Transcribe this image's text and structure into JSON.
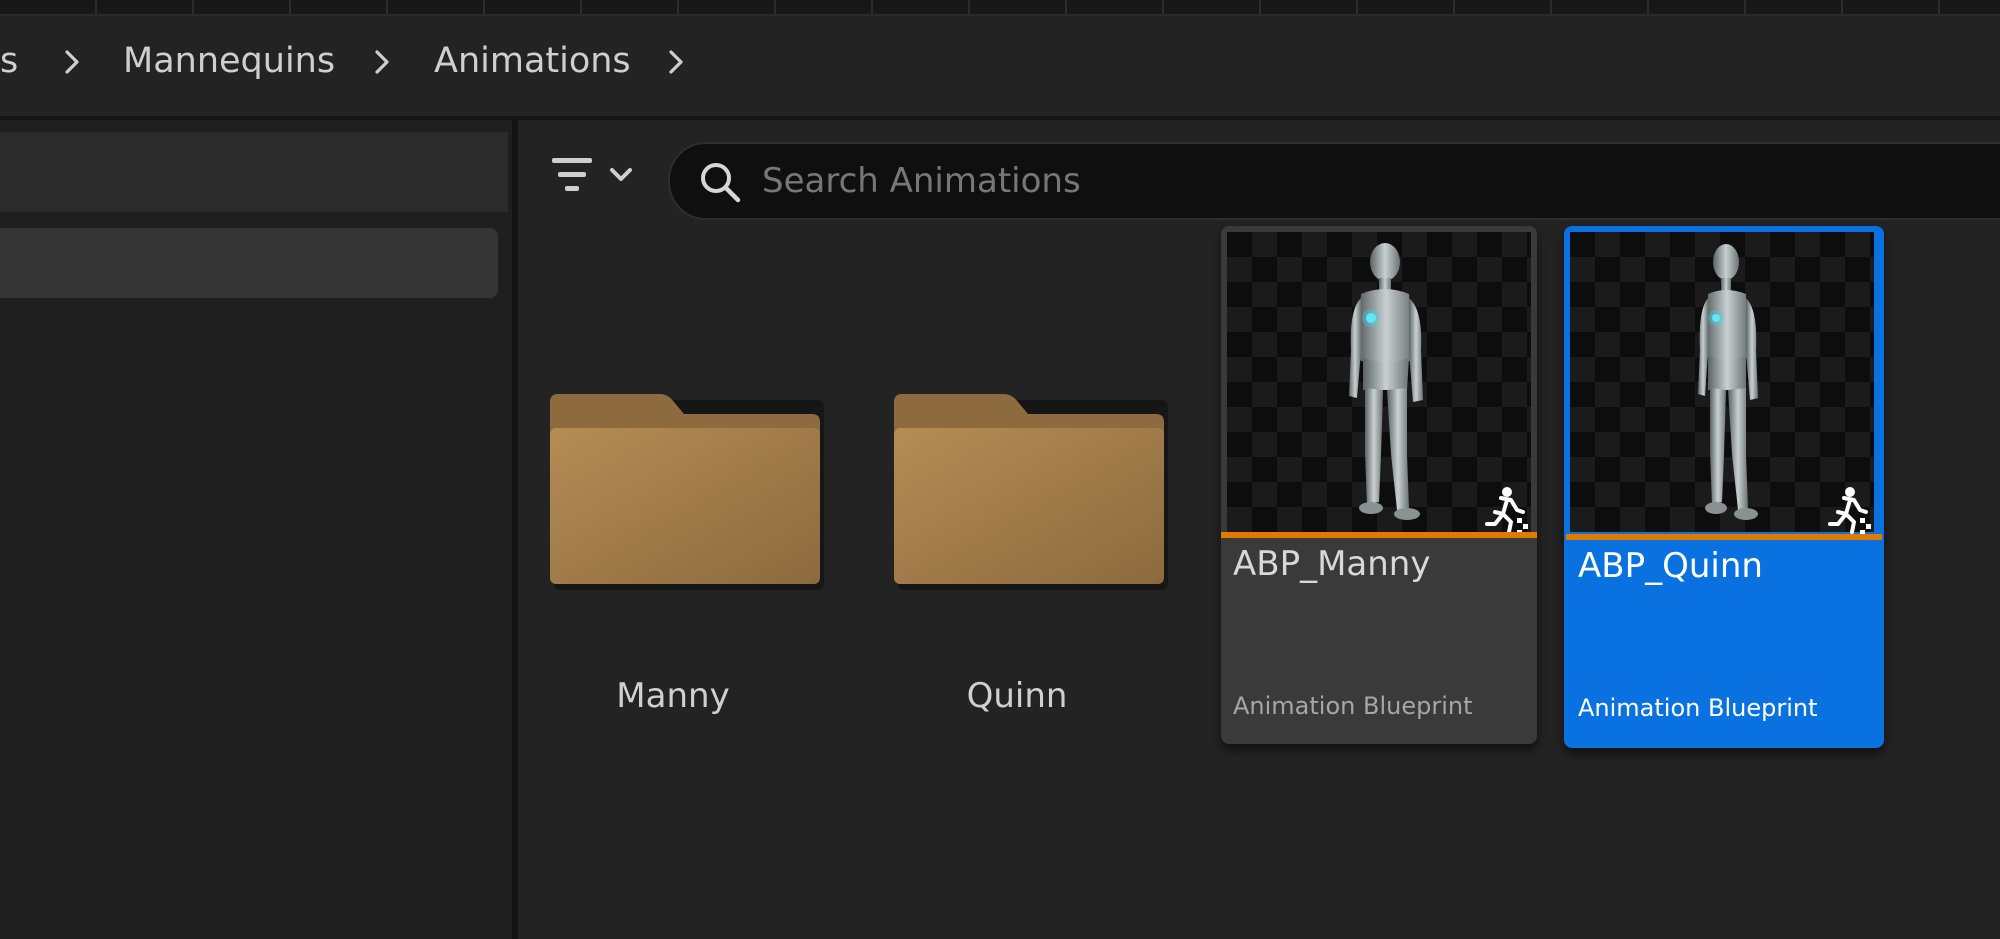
{
  "breadcrumb": {
    "items": [
      {
        "label": "s"
      },
      {
        "label": "Mannequins"
      },
      {
        "label": "Animations"
      }
    ]
  },
  "search": {
    "placeholder": "Search Animations",
    "value": ""
  },
  "folders": [
    {
      "name": "Manny"
    },
    {
      "name": "Quinn"
    }
  ],
  "assets": [
    {
      "name": "ABP_Manny",
      "type": "Animation Blueprint",
      "selected": false
    },
    {
      "name": "ABP_Quinn",
      "type": "Animation Blueprint",
      "selected": true
    }
  ],
  "colors": {
    "folder": "#a8844f",
    "selection": "#0a72e0",
    "asset_type_bar": "#e07b00",
    "background": "#232323"
  },
  "icons": {
    "breadcrumb_separator": "chevron-right-icon",
    "filter": "filter-icon",
    "search": "search-icon",
    "folder": "folder-icon",
    "asset_badge": "animation-blueprint-icon"
  }
}
